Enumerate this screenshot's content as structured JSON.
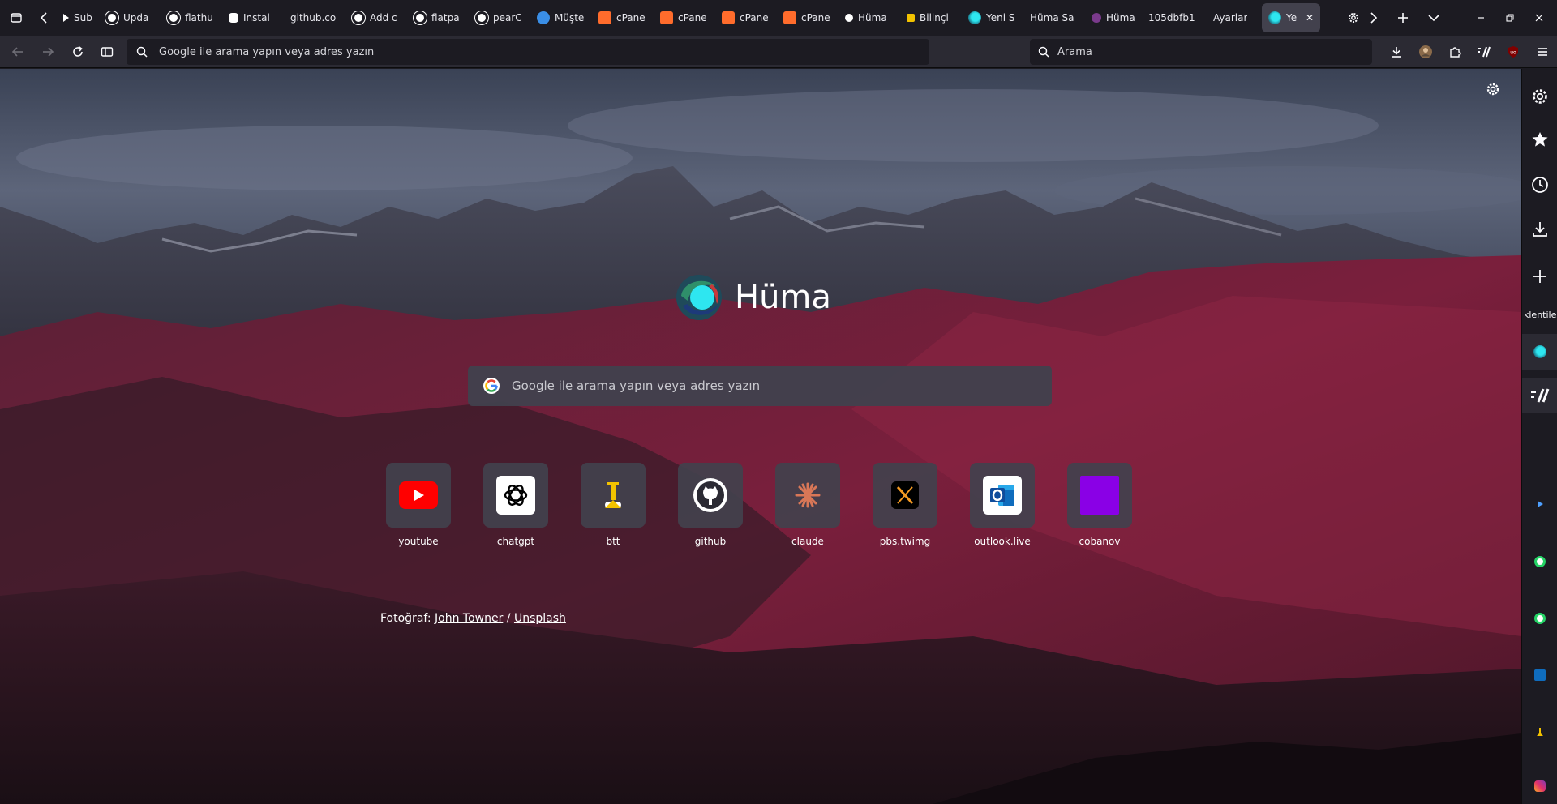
{
  "tabstrip": {
    "tabs": [
      {
        "label": "Subm",
        "icon": "play-icon"
      },
      {
        "label": "Upda",
        "icon": "github-icon"
      },
      {
        "label": "flathu",
        "icon": "github-icon"
      },
      {
        "label": "Instal",
        "icon": "app-icon"
      },
      {
        "label": "github.co",
        "icon": ""
      },
      {
        "label": "Add c",
        "icon": "github-icon"
      },
      {
        "label": "flatpa",
        "icon": "github-icon"
      },
      {
        "label": "pearC",
        "icon": "github-icon"
      },
      {
        "label": "Müşte",
        "icon": "globe-icon"
      },
      {
        "label": "cPane",
        "icon": "cpanel-icon"
      },
      {
        "label": "cPane",
        "icon": "cpanel-icon"
      },
      {
        "label": "cPane",
        "icon": "cpanel-icon"
      },
      {
        "label": "cPane",
        "icon": "cpanel-icon"
      },
      {
        "label": "Hüma",
        "icon": "huma-icon"
      },
      {
        "label": "Bilinçl",
        "icon": "bilinc-icon"
      },
      {
        "label": "Yeni S",
        "icon": "huma-icon"
      },
      {
        "label": "Hüma Sa",
        "icon": ""
      },
      {
        "label": "Hüma",
        "icon": "huma-dark-icon"
      },
      {
        "label": "105dbfb1",
        "icon": ""
      },
      {
        "label": "Ayarlar",
        "icon": ""
      },
      {
        "label": "Yen",
        "icon": "huma-icon",
        "active": true
      }
    ],
    "close_symbol": "✕"
  },
  "navbar": {
    "url_placeholder": "Google ile arama yapın veya adres yazın",
    "search_placeholder": "Arama"
  },
  "content": {
    "brand_name": "Hüma",
    "search_placeholder": "Google ile arama yapın veya adres yazın",
    "shortcuts": [
      {
        "label": "youtube",
        "icon": "youtube-icon"
      },
      {
        "label": "chatgpt",
        "icon": "chatgpt-icon"
      },
      {
        "label": "btt",
        "icon": "btt-icon"
      },
      {
        "label": "github",
        "icon": "github-icon"
      },
      {
        "label": "claude",
        "icon": "claude-icon"
      },
      {
        "label": "pbs.twimg",
        "icon": "x-icon"
      },
      {
        "label": "outlook.live",
        "icon": "outlook-icon"
      },
      {
        "label": "cobanov",
        "icon": "purple-square-icon"
      }
    ],
    "credit": {
      "prefix": "Fotoğraf:",
      "author": "John Towner",
      "separator": "/",
      "source": "Unsplash"
    }
  },
  "sidebar": {
    "label": "klentile"
  },
  "colors": {
    "chrome_dark": "#1c1b22",
    "toolbar": "#2b2a33",
    "tile": "#42414d",
    "youtube_red": "#ff0000",
    "claude_orange": "#d97757",
    "outlook_blue": "#0f6cbd",
    "cobanov_purple": "#8a00e6",
    "huma_cyan": "#2ee6f0"
  }
}
